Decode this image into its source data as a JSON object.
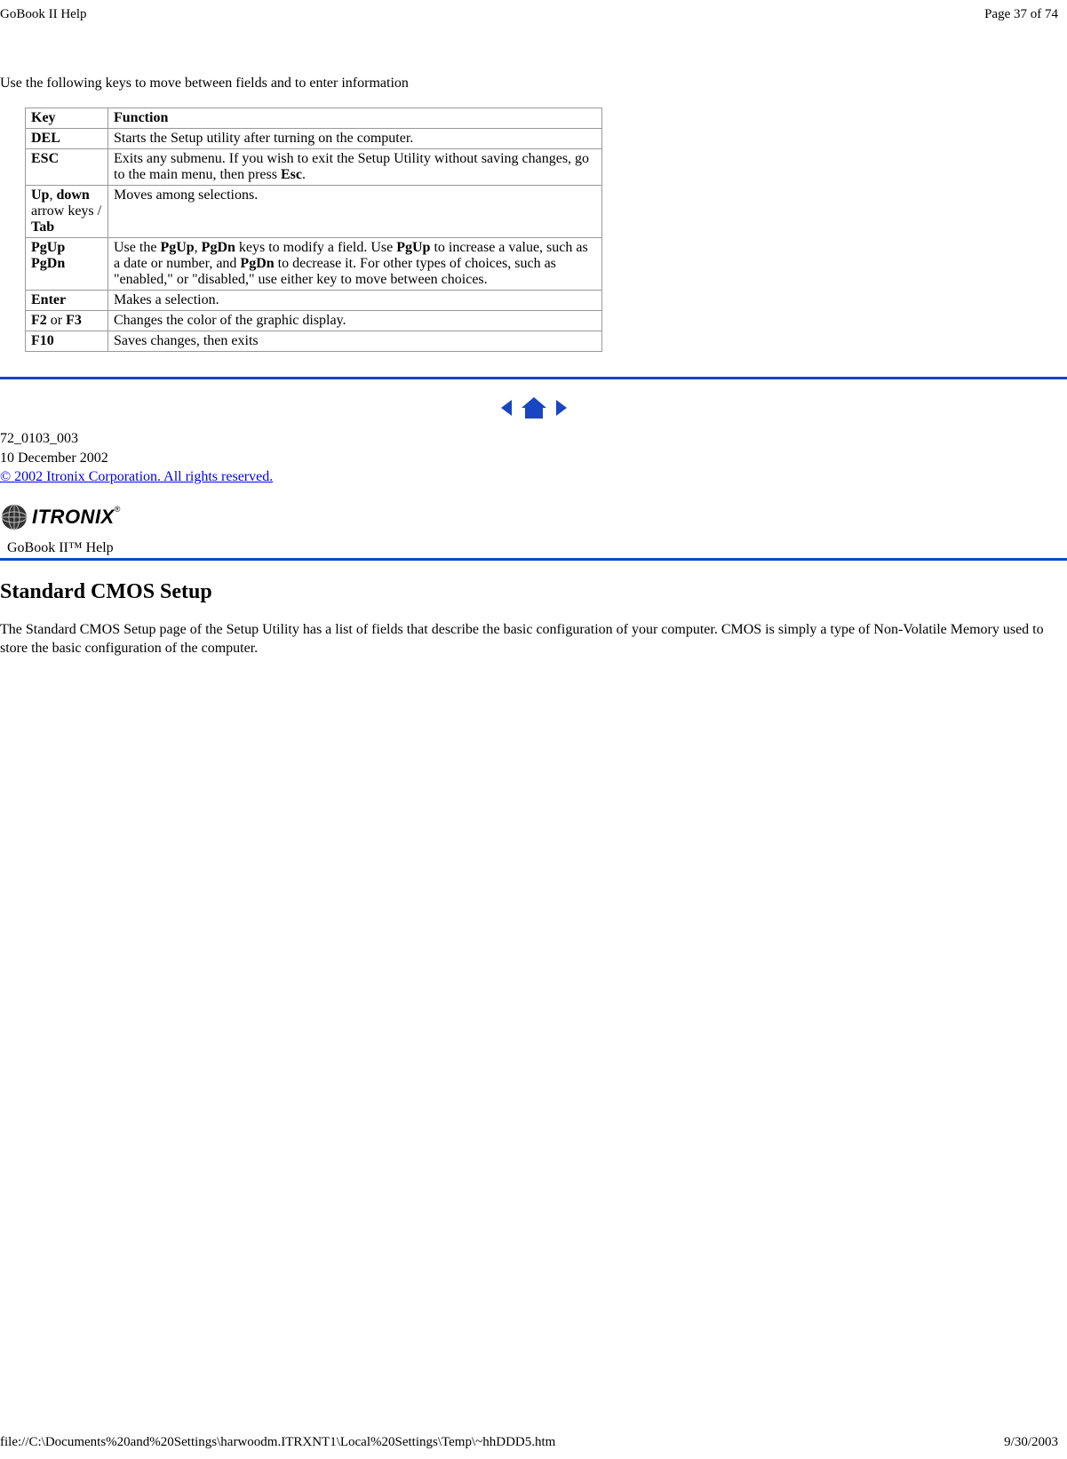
{
  "header": {
    "title": "GoBook II Help",
    "page_label": "Page 37 of 74"
  },
  "intro": "Use the following keys to move between fields and to enter information",
  "table": {
    "head": {
      "key": "Key",
      "function": "Function"
    },
    "rows": [
      {
        "key_html": "<b>DEL</b>",
        "fn_html": "Starts the Setup utility after turning on the computer."
      },
      {
        "key_html": "<b>ESC</b>",
        "fn_html": "Exits any submenu.  If you wish to exit the Setup Utility without saving changes, go to the main menu, then press <b>Esc</b>."
      },
      {
        "key_html": "<b>Up</b>, <b>down</b> arrow keys / <b>Tab</b>",
        "fn_html": "Moves among selections."
      },
      {
        "key_html": "<b>PgUp</b> <b>PgDn</b>",
        "fn_html": "Use the <b>PgUp</b>, <b>PgDn</b> keys to modify a field.  Use <b>PgUp</b> to increase a value, such as a date or number, and <b>PgDn</b> to decrease it.  For other types of choices, such as \"enabled,\" or \"disabled,\" use either key to move between choices."
      },
      {
        "key_html": "<b>Enter</b>",
        "fn_html": "Makes a selection."
      },
      {
        "key_html": "<b>F2</b> or <b>F3</b>",
        "fn_html": "Changes the color of the graphic display."
      },
      {
        "key_html": "<b>F10</b>",
        "fn_html": "Saves changes, then exits"
      }
    ]
  },
  "meta": {
    "doc_id": "72_0103_003",
    "date": "10 December 2002",
    "copyright": "© 2002 Itronix Corporation.  All rights reserved."
  },
  "brand": {
    "logo_text": "ITRONIX",
    "help_label": "GoBook II™ Help"
  },
  "section": {
    "heading": "Standard CMOS Setup",
    "body": "The Standard CMOS Setup page of the Setup Utility has a list of fields that describe the basic configuration of your computer.  CMOS is simply a type of Non-Volatile Memory used to store the basic configuration of the computer."
  },
  "footer": {
    "path": "file://C:\\Documents%20and%20Settings\\harwoodm.ITRXNT1\\Local%20Settings\\Temp\\~hhDDD5.htm",
    "date": "9/30/2003"
  }
}
